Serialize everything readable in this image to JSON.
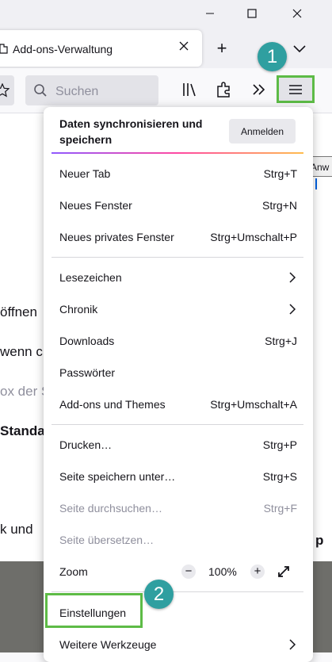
{
  "window": {
    "minimize": "—",
    "maximize": "□",
    "close": "✕"
  },
  "tab": {
    "title": "Add-ons-Verwaltung",
    "close_icon": "close-icon",
    "new_tab": "+"
  },
  "toolbar": {
    "search_placeholder": "Suchen",
    "overflow": "»"
  },
  "tooltip": {
    "text": "Anw"
  },
  "page": {
    "line1": "öffnen",
    "line2": "wenn c",
    "line3": "ox der S",
    "line4": "Standa",
    "line5": "k und",
    "line6": "p"
  },
  "menu": {
    "sync_title": "Daten synchronisieren und speichern",
    "signin_label": "Anmelden",
    "items": [
      {
        "label": "Neuer Tab",
        "shortcut": "Strg+T"
      },
      {
        "label": "Neues Fenster",
        "shortcut": "Strg+N"
      },
      {
        "label": "Neues privates Fenster",
        "shortcut": "Strg+Umschalt+P"
      },
      {
        "label": "Lesezeichen",
        "shortcut": ""
      },
      {
        "label": "Chronik",
        "shortcut": ""
      },
      {
        "label": "Downloads",
        "shortcut": "Strg+J"
      },
      {
        "label": "Passwörter",
        "shortcut": ""
      },
      {
        "label": "Add-ons und Themes",
        "shortcut": "Strg+Umschalt+A"
      },
      {
        "label": "Drucken…",
        "shortcut": "Strg+P"
      },
      {
        "label": "Seite speichern unter…",
        "shortcut": "Strg+S"
      },
      {
        "label": "Seite durchsuchen…",
        "shortcut": "Strg+F"
      },
      {
        "label": "Seite übersetzen…",
        "shortcut": ""
      },
      {
        "label": "Zoom",
        "shortcut": ""
      },
      {
        "label": "Einstellungen",
        "shortcut": ""
      },
      {
        "label": "Weitere Werkzeuge",
        "shortcut": ""
      }
    ],
    "zoom": {
      "minus": "−",
      "value": "100%",
      "plus": "+"
    }
  },
  "badges": {
    "one": "1",
    "two": "2"
  },
  "colors": {
    "highlight": "#5dbb46",
    "badge": "#2f9fa0"
  }
}
